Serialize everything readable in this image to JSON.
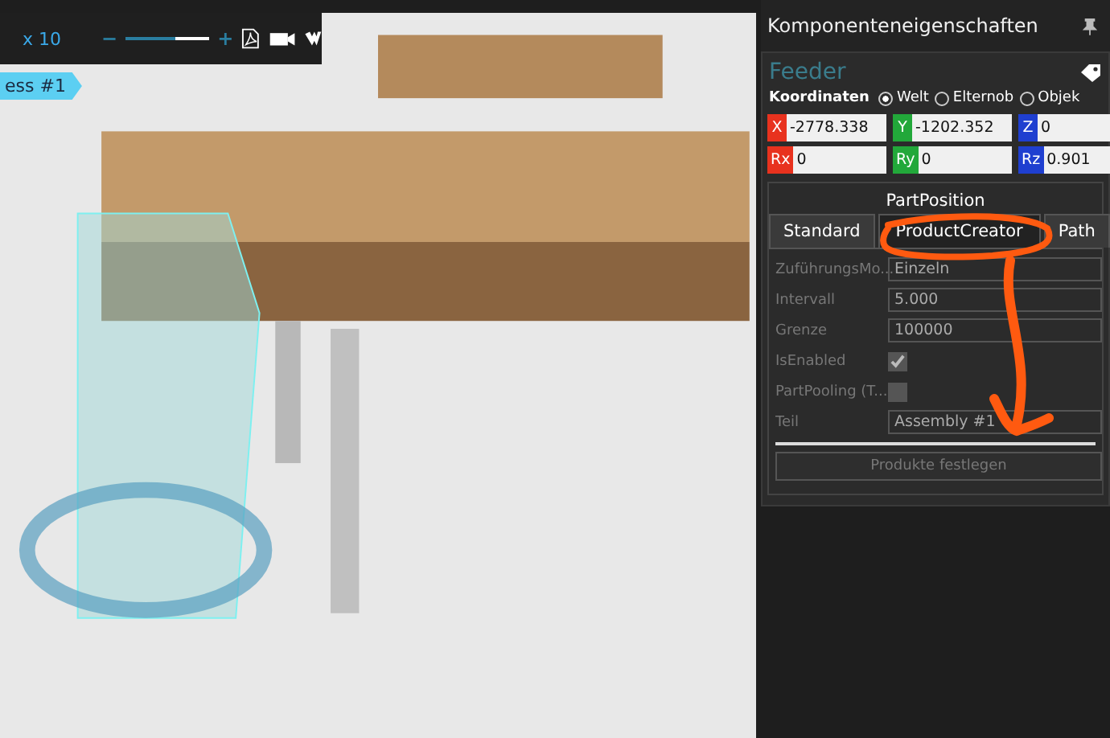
{
  "toolbar": {
    "zoom_label": "x 10",
    "minus": "−",
    "plus": "+",
    "slider": {
      "level": 0.6
    }
  },
  "scene_tag": "ess #1",
  "panel": {
    "title": "Komponenteneigenschaften",
    "component": "Feeder",
    "coord_label": "Koordinaten",
    "coord_modes": [
      {
        "label": "Welt",
        "selected": true
      },
      {
        "label": "Elternob",
        "selected": false
      },
      {
        "label": "Objek",
        "selected": false
      }
    ],
    "coords": [
      {
        "label": "X",
        "value": "-2778.338",
        "color": "#e8321e"
      },
      {
        "label": "Y",
        "value": "-1202.352",
        "color": "#22a83a"
      },
      {
        "label": "Z",
        "value": "0",
        "color": "#1f3fd0"
      },
      {
        "label": "Rx",
        "value": "0",
        "color": "#e8321e"
      },
      {
        "label": "Ry",
        "value": "0",
        "color": "#22a83a"
      },
      {
        "label": "Rz",
        "value": "0.901",
        "color": "#1f3fd0"
      }
    ],
    "section": "PartPosition",
    "tabs": [
      {
        "label": "Standard",
        "selected": false
      },
      {
        "label": "ProductCreator",
        "selected": true
      },
      {
        "label": "Path",
        "selected": false
      }
    ],
    "properties": [
      {
        "kind": "field",
        "label": "ZuführungsMo...",
        "value": "Einzeln"
      },
      {
        "kind": "field",
        "label": "Intervall",
        "value": "5.000"
      },
      {
        "kind": "field",
        "label": "Grenze",
        "value": "100000"
      },
      {
        "kind": "checkbox",
        "label": "IsEnabled",
        "checked": true
      },
      {
        "kind": "checkbox",
        "label": "PartPooling (T...",
        "checked": false
      },
      {
        "kind": "field",
        "label": "Teil",
        "value": "Assembly #1"
      }
    ],
    "button": "Produkte festlegen"
  }
}
